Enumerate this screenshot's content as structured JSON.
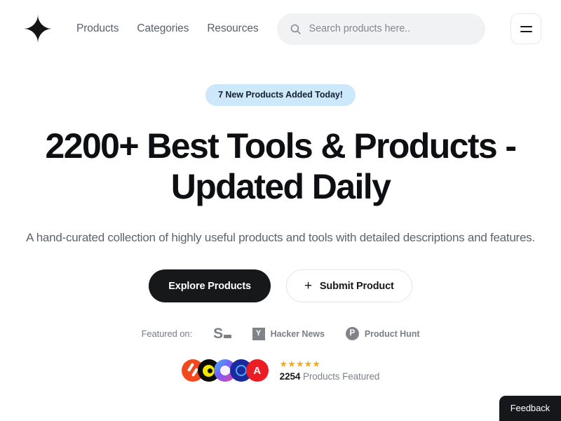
{
  "header": {
    "logo_name": "brand-logo",
    "nav": [
      {
        "label": "Products"
      },
      {
        "label": "Categories"
      },
      {
        "label": "Resources"
      }
    ],
    "search": {
      "placeholder": "Search products here..",
      "value": "",
      "icon": "search-icon"
    },
    "menu_icon": "hamburger-menu-icon"
  },
  "hero": {
    "badge": "7 New Products Added Today!",
    "badge_bg": "#cde7fb",
    "headline": "2200+ Best Tools & Products - Updated Daily",
    "subtitle": "A hand-curated collection of highly useful products and tools with detailed descriptions and features.",
    "primary_cta": "Explore Products",
    "secondary_cta": "Submit Product",
    "secondary_cta_icon": "plus-icon"
  },
  "featured": {
    "label": "Featured on:",
    "brands": [
      {
        "name": "Starter Story",
        "mark": "S",
        "text": ""
      },
      {
        "name": "Hacker News",
        "mark": "Y",
        "text": "Hacker News"
      },
      {
        "name": "Product Hunt",
        "mark": "P",
        "text": "Product Hunt"
      }
    ]
  },
  "proof": {
    "avatars": [
      {
        "name": "product-avatar-1",
        "color": "#f24a1e"
      },
      {
        "name": "product-avatar-2",
        "color": "#0a0a0a"
      },
      {
        "name": "product-avatar-3",
        "color": "#7b5cf5"
      },
      {
        "name": "product-avatar-4",
        "color": "#1a2a9c"
      },
      {
        "name": "product-avatar-5",
        "color": "#ec1c24",
        "letter": "A"
      }
    ],
    "stars": "★★★★★",
    "star_color": "#f4a81d",
    "count": "2254",
    "count_suffix": "Products Featured"
  },
  "feedback": {
    "label": "Feedback"
  }
}
